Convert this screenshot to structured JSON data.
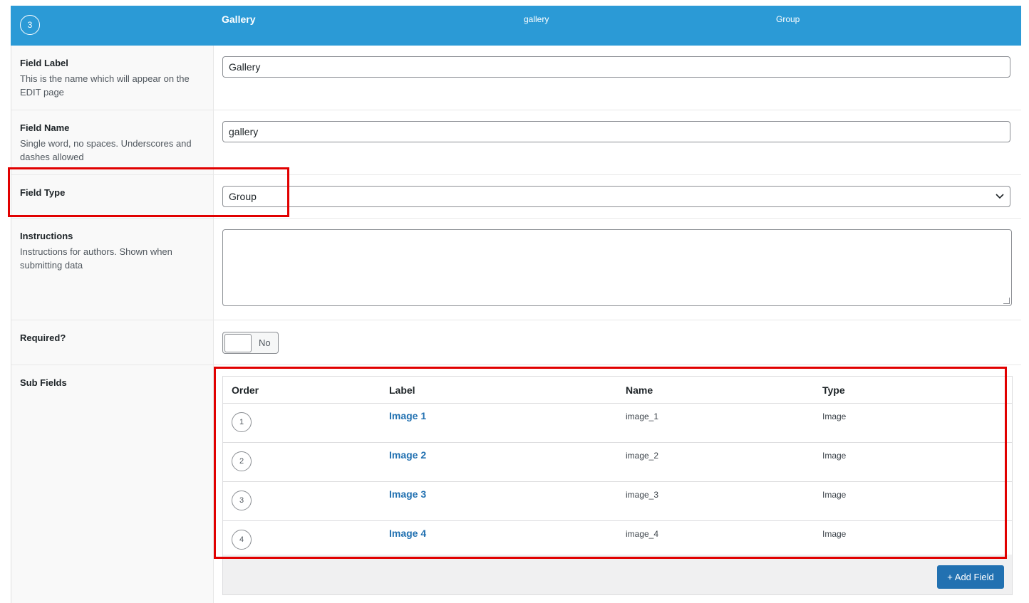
{
  "field_header": {
    "order": "3",
    "label": "Gallery",
    "name": "gallery",
    "type": "Group"
  },
  "rows": {
    "field_label": {
      "title": "Field Label",
      "description": "This is the name which will appear on the EDIT page",
      "value": "Gallery"
    },
    "field_name": {
      "title": "Field Name",
      "description": "Single word, no spaces. Underscores and dashes allowed",
      "value": "gallery"
    },
    "field_type": {
      "title": "Field Type",
      "value": "Group"
    },
    "instructions": {
      "title": "Instructions",
      "description": "Instructions for authors. Shown when submitting data",
      "value": ""
    },
    "required": {
      "title": "Required?",
      "toggle_text": "No"
    },
    "sub_fields": {
      "title": "Sub Fields"
    }
  },
  "sub_fields_table": {
    "columns": [
      "Order",
      "Label",
      "Name",
      "Type"
    ],
    "rows": [
      {
        "order": "1",
        "label": "Image 1",
        "name": "image_1",
        "type": "Image"
      },
      {
        "order": "2",
        "label": "Image 2",
        "name": "image_2",
        "type": "Image"
      },
      {
        "order": "3",
        "label": "Image 3",
        "name": "image_3",
        "type": "Image"
      },
      {
        "order": "4",
        "label": "Image 4",
        "name": "image_4",
        "type": "Image"
      }
    ],
    "add_button": "+ Add Field"
  },
  "colors": {
    "header_bg": "#2b9ad6",
    "link": "#2271b1",
    "highlight": "#e10000"
  }
}
